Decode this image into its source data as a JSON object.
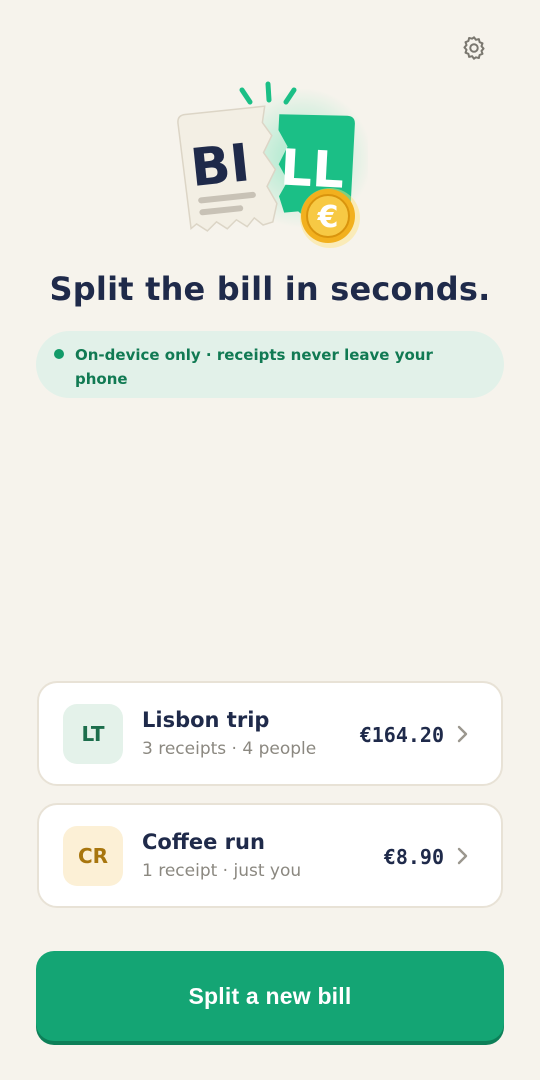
{
  "header": {
    "settings_icon": "gear-icon"
  },
  "logo": {
    "word_left": "BI",
    "word_right": "LL",
    "coin_symbol": "€",
    "colors": {
      "green": "#1bbf86",
      "paper": "#f3efe4",
      "coin": "#f2b01e",
      "ink": "#1f2a4a"
    }
  },
  "headline": "Split the bill in seconds.",
  "privacy": {
    "text": "On-device only · receipts never leave your phone"
  },
  "bills": [
    {
      "initials": "LT",
      "title": "Lisbon trip",
      "subtitle": "3 receipts · 4 people",
      "amount": "€164.20"
    },
    {
      "initials": "CR",
      "title": "Coffee run",
      "subtitle": "1 receipt · just you",
      "amount": "€8.90"
    }
  ],
  "primary_action": {
    "label": "Split a new bill"
  },
  "colors": {
    "accent": "#14a574",
    "background": "#f6f3ec",
    "text": "#1f2a4a"
  }
}
